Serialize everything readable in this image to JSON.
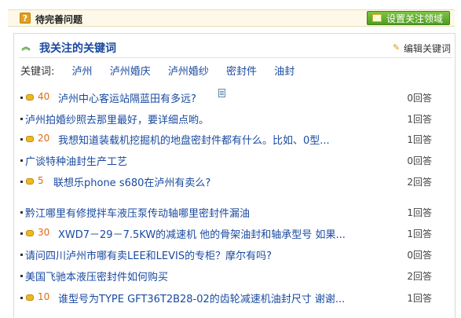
{
  "header": {
    "title": "待完善问题",
    "set_button": "设置关注领域"
  },
  "keywords_section": {
    "title": "我关注的关键词",
    "edit_label": "编辑关键词",
    "label": "关键词:",
    "keywords": [
      "泸州",
      "泸州婚庆",
      "泸州婚纱",
      "密封件",
      "油封"
    ]
  },
  "questions": [
    {
      "bounty": "40",
      "title": "泸州中心客运站隔蓝田有多远?",
      "answers": "0回答"
    },
    {
      "bounty": "",
      "title": "泸州拍婚纱照去那里最好，要详细点哟。",
      "answers": "1回答"
    },
    {
      "bounty": "20",
      "title": "我想知道装载机挖掘机的地盘密封件都有什么。比如、0型...",
      "answers": "1回答"
    },
    {
      "bounty": "",
      "title": "广谈特种油封生产工艺",
      "answers": "0回答"
    },
    {
      "bounty": "5",
      "title": "联想乐phone s680在泸州有卖么?",
      "answers": "2回答"
    },
    {
      "bounty": "",
      "title": "黔江哪里有修搅拌车液压泵传动轴哪里密封件漏油",
      "answers": "1回答"
    },
    {
      "bounty": "30",
      "title": "XWD7－29－7.5KW的减速机 他的骨架油封和轴承型号 如果...",
      "answers": "1回答"
    },
    {
      "bounty": "",
      "title": "请问四川泸州市哪有卖LEE和LEVIS的专柜？摩尔有吗?",
      "answers": "0回答"
    },
    {
      "bounty": "",
      "title": "美国飞驰本液压密封件如何购买",
      "answers": "2回答"
    },
    {
      "bounty": "10",
      "title": "谁型号为TYPE GFT36T2B28-02的齿轮减速机油封尺寸 谢谢...",
      "answers": "1回答"
    }
  ]
}
